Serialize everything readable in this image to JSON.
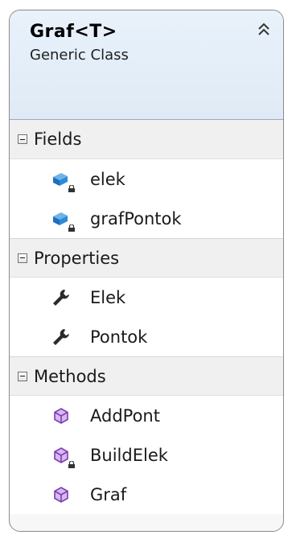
{
  "class": {
    "name": "Graf<T>",
    "kind": "Generic Class"
  },
  "sections": {
    "fields": {
      "label": "Fields",
      "items": [
        {
          "label": "elek",
          "icon": "field-private-icon"
        },
        {
          "label": "grafPontok",
          "icon": "field-private-icon"
        }
      ]
    },
    "properties": {
      "label": "Properties",
      "items": [
        {
          "label": "Elek",
          "icon": "property-wrench-icon"
        },
        {
          "label": "Pontok",
          "icon": "property-wrench-icon"
        }
      ]
    },
    "methods": {
      "label": "Methods",
      "items": [
        {
          "label": "AddPont",
          "icon": "method-icon"
        },
        {
          "label": "BuildElek",
          "icon": "method-private-icon"
        },
        {
          "label": "Graf",
          "icon": "method-icon"
        }
      ]
    }
  },
  "colors": {
    "header_bg": "#e3edf8",
    "field_icon": "#1e6fbf",
    "method_icon": "#7a3fb0",
    "border": "#8a8a8a"
  }
}
